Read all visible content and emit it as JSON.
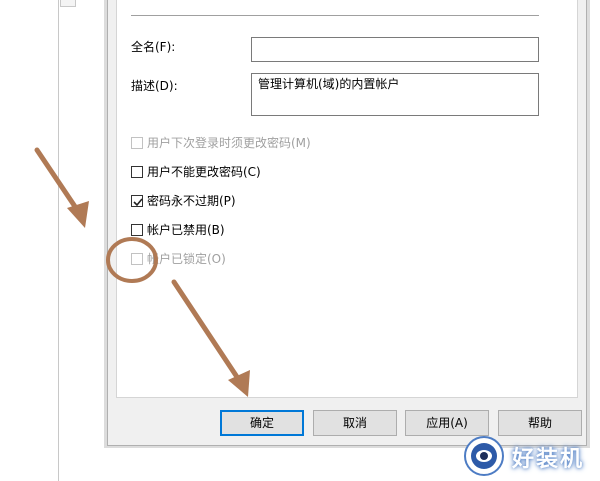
{
  "account_properties": {
    "full_name": {
      "label": "全名(F):",
      "value": ""
    },
    "description": {
      "label": "描述(D):",
      "value": "管理计算机(域)的内置帐户"
    },
    "options": [
      {
        "label": "用户下次登录时须更改密码(M)",
        "checked": false,
        "disabled": true
      },
      {
        "label": "用户不能更改密码(C)",
        "checked": false,
        "disabled": false
      },
      {
        "label": "密码永不过期(P)",
        "checked": true,
        "disabled": false
      },
      {
        "label": "帐户已禁用(B)",
        "checked": false,
        "disabled": false
      },
      {
        "label": "帐户已锁定(O)",
        "checked": false,
        "disabled": true
      }
    ]
  },
  "buttons": {
    "ok": "确定",
    "cancel": "取消",
    "apply": "应用(A)",
    "help": "帮助"
  },
  "annotations": {
    "arrow_color": "#b07a55"
  },
  "watermark": {
    "text": "好装机"
  }
}
